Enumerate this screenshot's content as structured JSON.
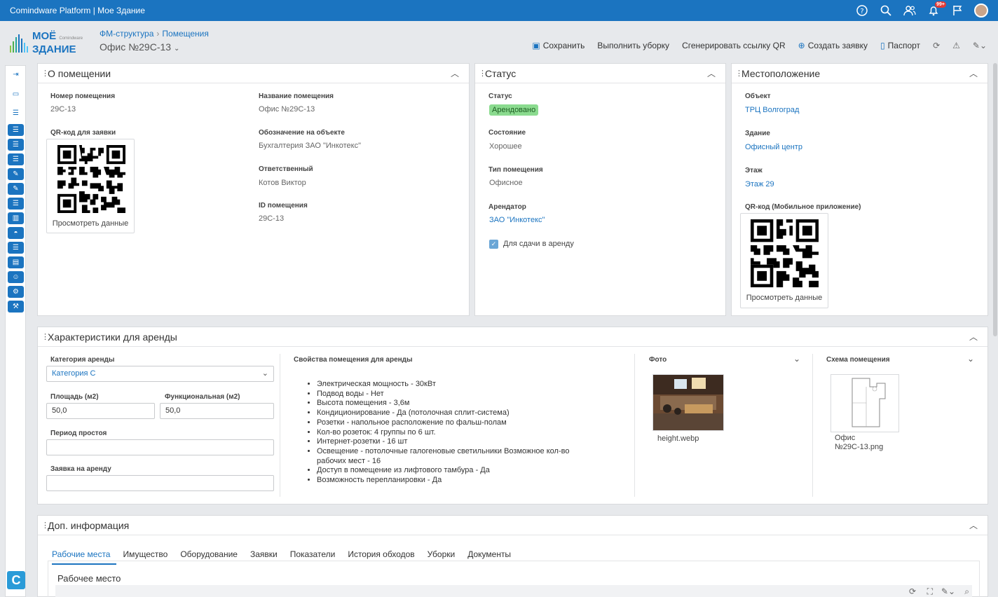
{
  "topbar": {
    "title": "Comindware Platform | Мое Здание",
    "notifications_badge": "99+"
  },
  "logo": {
    "line1": "МОЁ",
    "line2": "ЗДАНИЕ",
    "small": "Comindware"
  },
  "breadcrumb": {
    "item1": "ФМ-структура",
    "item2": "Помещения"
  },
  "page": {
    "title": "Офис №29С-13"
  },
  "toolbar": {
    "save": "Сохранить",
    "clean": "Выполнить уборку",
    "qr": "Сгенерировать ссылку QR",
    "create": "Создать заявку",
    "passport": "Паспорт"
  },
  "about": {
    "title": "О помещении",
    "number_label": "Номер помещения",
    "number": "29С-13",
    "qr_label": "QR-код для заявки",
    "qr_caption": "Просмотреть данные",
    "name_label": "Название помещения",
    "name": "Офис №29С-13",
    "designation_label": "Обозначение на объекте",
    "designation": "Бухгалтерия ЗАО \"Инкотекс\"",
    "responsible_label": "Ответственный",
    "responsible": "Котов Виктор",
    "id_label": "ID помещения",
    "id": "29С-13"
  },
  "status": {
    "title": "Статус",
    "status_label": "Статус",
    "status": "Арендовано",
    "condition_label": "Состояние",
    "condition": "Хорошее",
    "type_label": "Тип помещения",
    "type": "Офисное",
    "tenant_label": "Арендатор",
    "tenant": "ЗАО \"Инкотекс\"",
    "for_rent": "Для сдачи в аренду"
  },
  "location": {
    "title": "Местоположение",
    "object_label": "Объект",
    "object": "ТРЦ Волгоград",
    "building_label": "Здание",
    "building": "Офисный центр",
    "floor_label": "Этаж",
    "floor": "Этаж 29",
    "qr_label": "QR-код (Мобильное приложение)",
    "qr_caption": "Просмотреть данные"
  },
  "rent": {
    "title": "Характеристики для аренды",
    "category_label": "Категория аренды",
    "category": "Категория С",
    "area_label": "Площадь (м2)",
    "area": "50,0",
    "func_label": "Функциональная (м2)",
    "func": "50,0",
    "idle_label": "Период простоя",
    "idle": "",
    "request_label": "Заявка на аренду",
    "request": "",
    "props_label": "Свойства помещения для аренды",
    "props": [
      "Электрическая мощность - 30кВт",
      "Подвод воды - Нет",
      "Высота помещения - 3,6м",
      "Кондиционирование - Да (потолочная сплит-система)",
      "Розетки - напольное расположение по фальш-полам",
      "Кол-во розеток: 4 группы по 6 шт.",
      "Интернет-розетки - 16 шт",
      "Освещение - потолочные галогеновые светильники Возможное кол-во рабочих мест - 16",
      "Доступ в помещение из лифтового тамбура  - Да",
      "Возможность перепланировки - Да"
    ],
    "photo_label": "Фото",
    "photo_file": "height.webp",
    "scheme_label": "Схема помещения",
    "scheme_file": "Офис №29С-13.png"
  },
  "extra": {
    "title": "Доп. информация",
    "tabs": [
      "Рабочие места",
      "Имущество",
      "Оборудование",
      "Заявки",
      "Показатели",
      "История обходов",
      "Уборки",
      "Документы"
    ],
    "section_title": "Рабочее место"
  },
  "colors": {
    "brand": "#1b74c0",
    "status_green": "#8bdb8f"
  }
}
